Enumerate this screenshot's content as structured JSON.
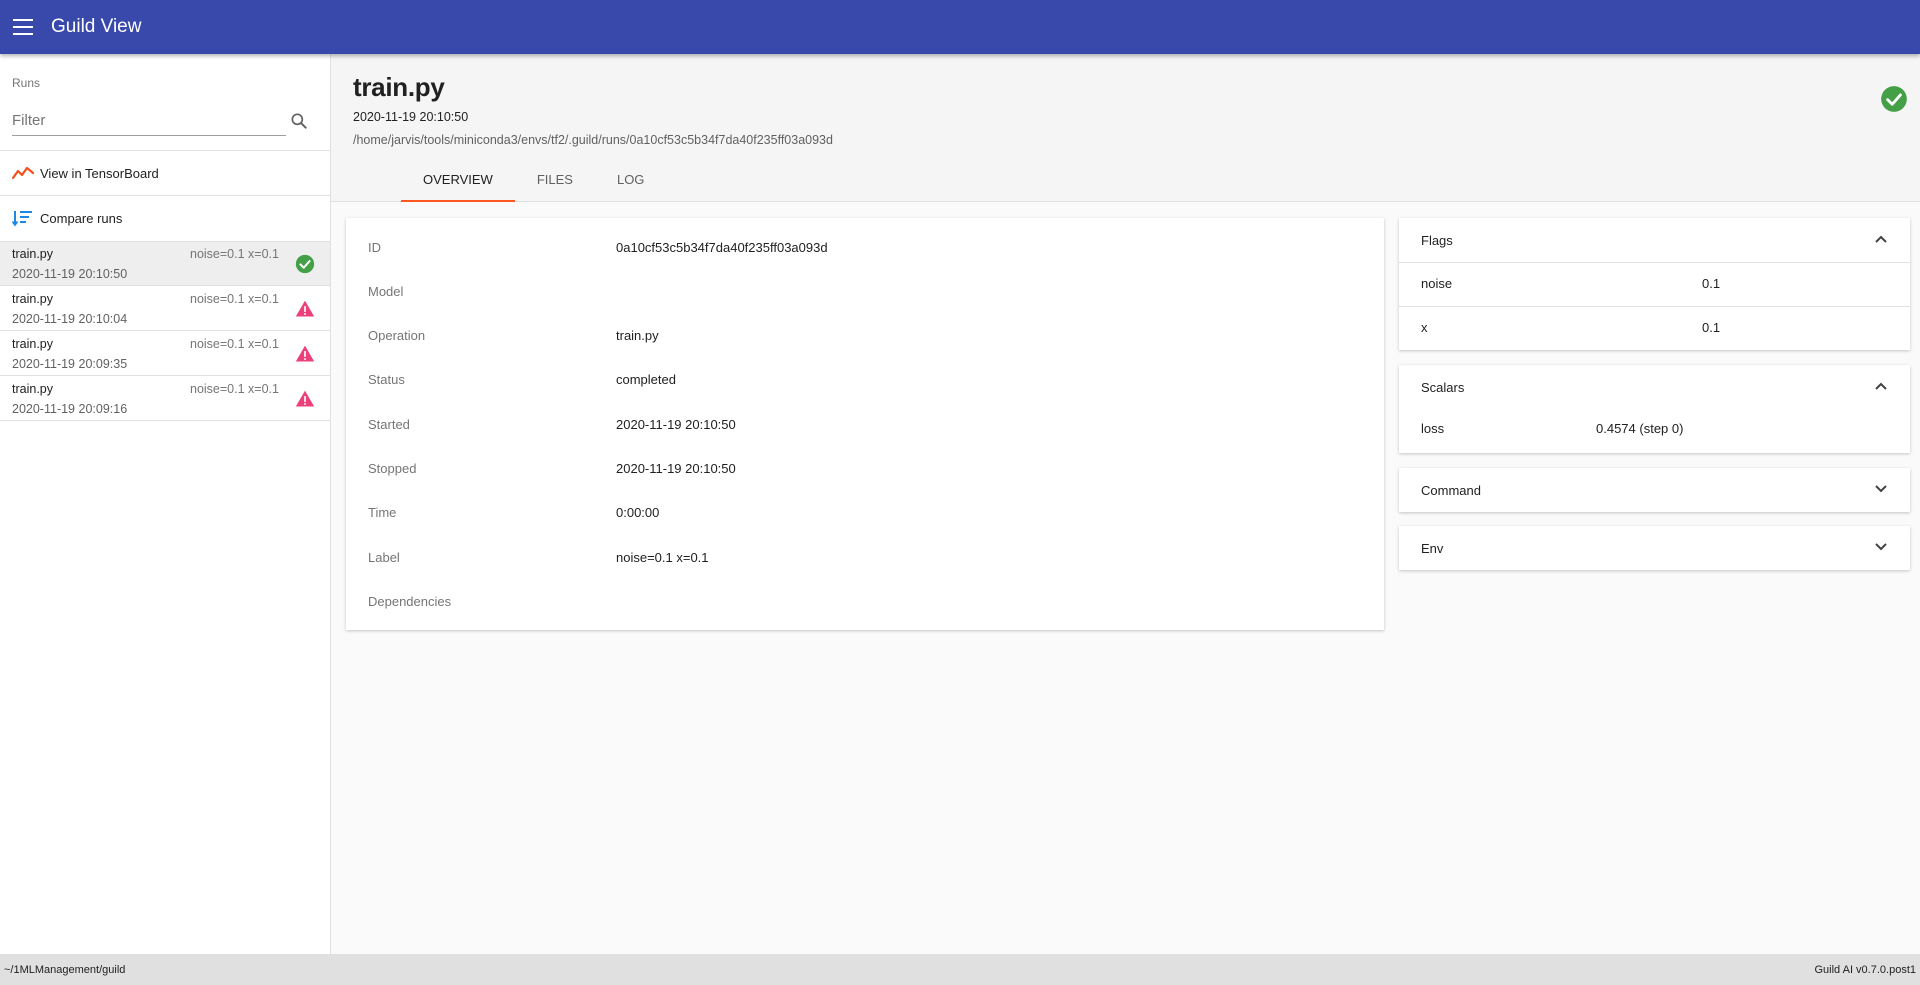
{
  "appbar": {
    "title": "Guild View",
    "menu_icon": "menu-icon"
  },
  "sidebar": {
    "runs_label": "Runs",
    "filter_placeholder": "Filter",
    "actions": [
      {
        "label": "View in TensorBoard",
        "icon": "tensorboard-icon",
        "color": "#f4511e"
      },
      {
        "label": "Compare runs",
        "icon": "compare-icon",
        "color": "#1e88e5"
      }
    ],
    "runs": [
      {
        "name": "train.py",
        "label": "noise=0.1 x=0.1",
        "date": "2020-11-19 20:10:50",
        "status": "completed",
        "selected": true
      },
      {
        "name": "train.py",
        "label": "noise=0.1 x=0.1",
        "date": "2020-11-19 20:10:04",
        "status": "error"
      },
      {
        "name": "train.py",
        "label": "noise=0.1 x=0.1",
        "date": "2020-11-19 20:09:35",
        "status": "error"
      },
      {
        "name": "train.py",
        "label": "noise=0.1 x=0.1",
        "date": "2020-11-19 20:09:16",
        "status": "error"
      }
    ]
  },
  "header": {
    "title": "train.py",
    "started": "2020-11-19 20:10:50",
    "path": "/home/jarvis/tools/miniconda3/envs/tf2/.guild/runs/0a10cf53c5b34f7da40f235ff03a093d",
    "status": "completed",
    "tabs": [
      {
        "label": "OVERVIEW",
        "active": true
      },
      {
        "label": "FILES"
      },
      {
        "label": "LOG"
      }
    ]
  },
  "overview": {
    "rows": [
      {
        "key": "ID",
        "value": "0a10cf53c5b34f7da40f235ff03a093d"
      },
      {
        "key": "Model",
        "value": ""
      },
      {
        "key": "Operation",
        "value": "train.py"
      },
      {
        "key": "Status",
        "value": "completed"
      },
      {
        "key": "Started",
        "value": "2020-11-19 20:10:50"
      },
      {
        "key": "Stopped",
        "value": "2020-11-19 20:10:50"
      },
      {
        "key": "Time",
        "value": "0:00:00"
      },
      {
        "key": "Label",
        "value": "noise=0.1 x=0.1"
      },
      {
        "key": "Dependencies",
        "value": ""
      }
    ]
  },
  "panels": {
    "flags": {
      "title": "Flags",
      "expanded": true,
      "rows": [
        {
          "key": "noise",
          "value": "0.1"
        },
        {
          "key": "x",
          "value": "0.1"
        }
      ]
    },
    "scalars": {
      "title": "Scalars",
      "expanded": true,
      "rows": [
        {
          "key": "loss",
          "value": "0.4574 (step 0)"
        }
      ]
    },
    "command": {
      "title": "Command",
      "expanded": false
    },
    "env": {
      "title": "Env",
      "expanded": false
    }
  },
  "statusbar": {
    "cwd": "~/1MLManagement/guild",
    "version": "Guild AI v0.7.0.post1"
  },
  "colors": {
    "primary": "#3949ab",
    "accent": "#ff5722",
    "success": "#43a047",
    "error": "#ec407a"
  }
}
